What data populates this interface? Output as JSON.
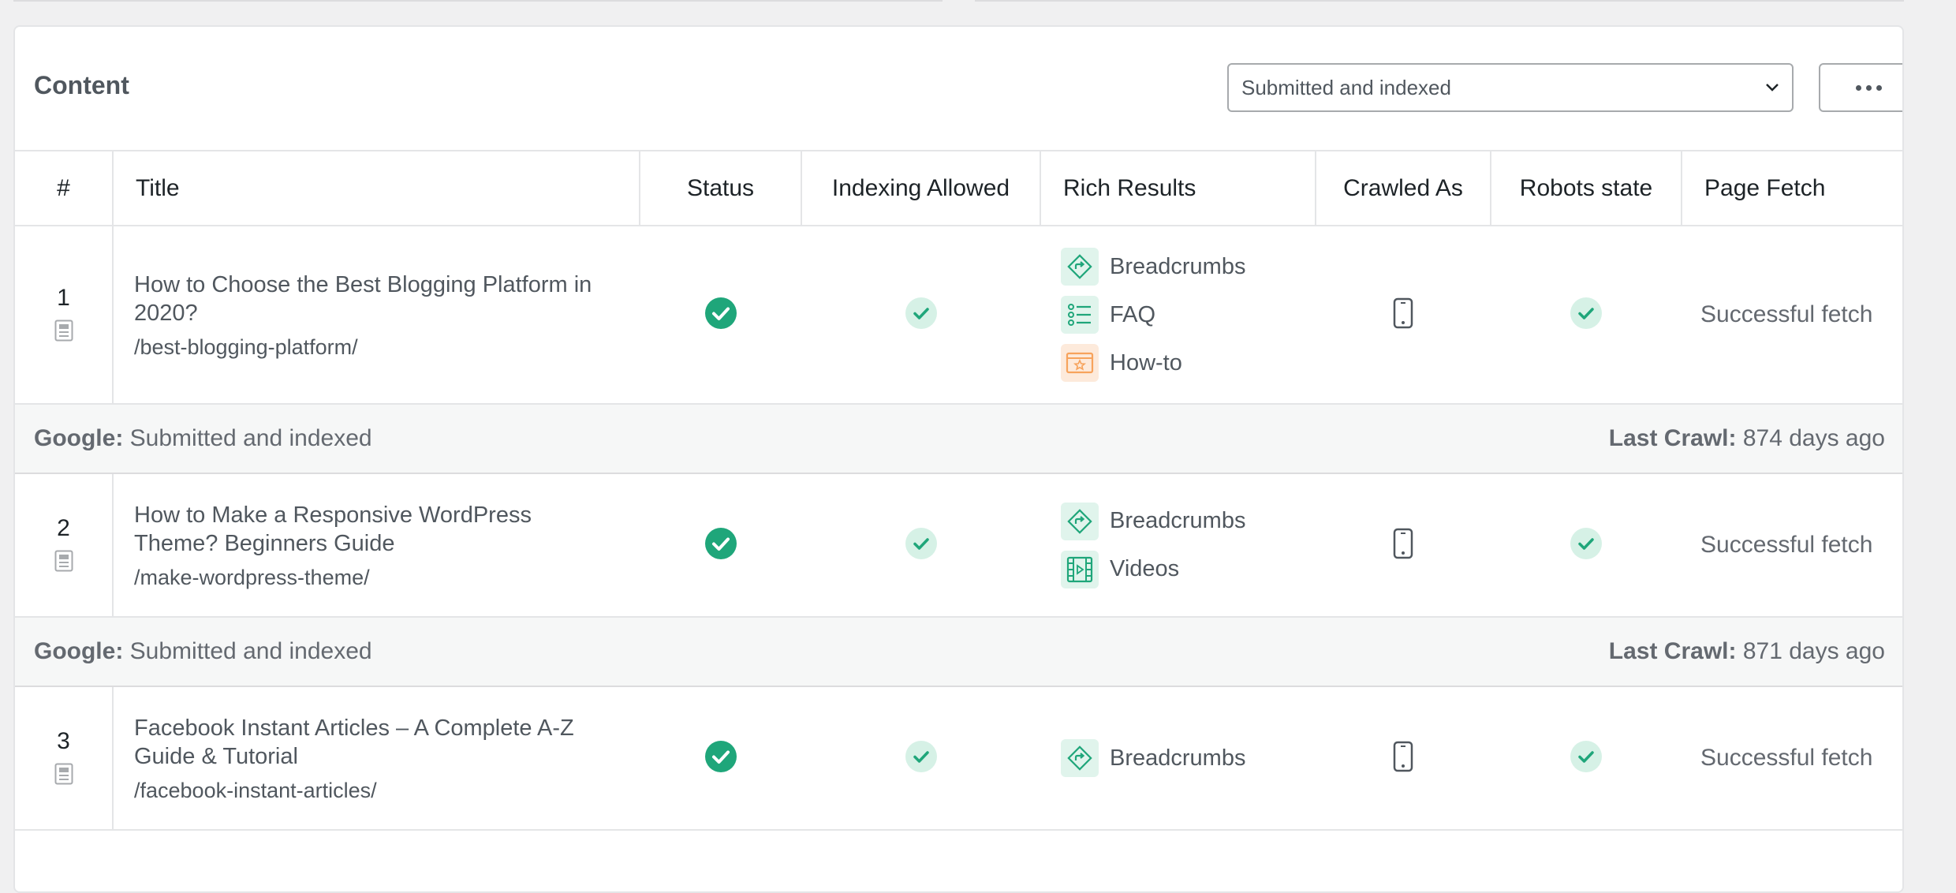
{
  "card": {
    "title": "Content",
    "filter": {
      "selected": "Submitted and indexed"
    }
  },
  "columns": {
    "num": "#",
    "title": "Title",
    "status": "Status",
    "indexing": "Indexing Allowed",
    "rich": "Rich Results",
    "crawled": "Crawled As",
    "robots": "Robots state",
    "fetch": "Page Fetch"
  },
  "rows": [
    {
      "num": "1",
      "title": "How to Choose the Best Blogging Platform in 2020?",
      "slug": "/best-blogging-platform/",
      "rich": [
        "Breadcrumbs",
        "FAQ",
        "How-to"
      ],
      "fetch": "Successful fetch",
      "google_label": "Google:",
      "google_value": "Submitted and indexed",
      "crawl_label": "Last Crawl:",
      "crawl_value": "874 days ago"
    },
    {
      "num": "2",
      "title": "How to Make a Responsive WordPress Theme? Beginners Guide",
      "slug": "/make-wordpress-theme/",
      "rich": [
        "Breadcrumbs",
        "Videos"
      ],
      "fetch": "Successful fetch",
      "google_label": "Google:",
      "google_value": "Submitted and indexed",
      "crawl_label": "Last Crawl:",
      "crawl_value": "871 days ago"
    },
    {
      "num": "3",
      "title": "Facebook Instant Articles – A Complete A-Z Guide & Tutorial",
      "slug": "/facebook-instant-articles/",
      "rich": [
        "Breadcrumbs"
      ],
      "fetch": "Successful fetch"
    }
  ],
  "icons": {
    "status": "check-circle-filled-icon",
    "indexing": "check-circle-light-icon",
    "crawled": "mobile-phone-icon",
    "robots": "check-circle-light-icon",
    "doc": "document-icon",
    "breadcrumbs": "breadcrumbs-icon",
    "faq": "faq-list-icon",
    "howto": "howto-icon",
    "videos": "video-film-icon"
  },
  "colors": {
    "green": "#1fa67a",
    "green_light": "#d6f1e6",
    "orange": "#f7a35c"
  }
}
